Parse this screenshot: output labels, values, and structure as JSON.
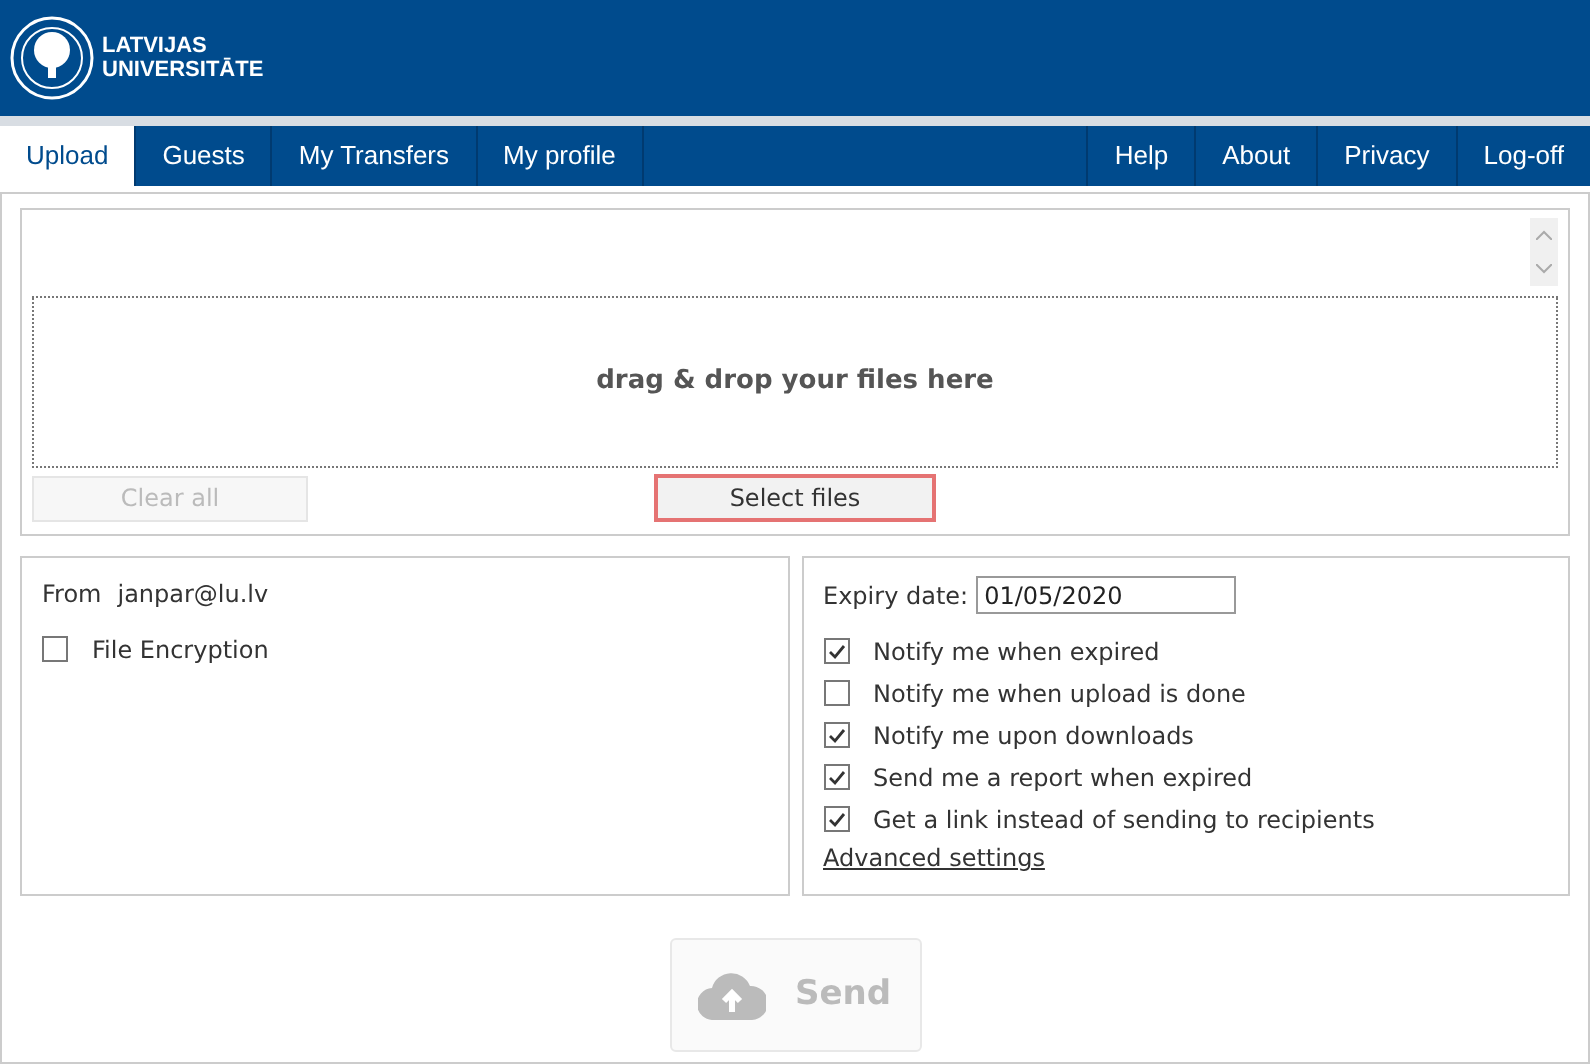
{
  "header": {
    "logo_lines": [
      "LATVIJAS",
      "UNIVERSITĀTE"
    ]
  },
  "nav": {
    "left": [
      {
        "label": "Upload",
        "selected": true
      },
      {
        "label": "Guests",
        "selected": false
      },
      {
        "label": "My Transfers",
        "selected": false
      },
      {
        "label": "My profile",
        "selected": false
      }
    ],
    "right": [
      {
        "label": "Help",
        "selected": false
      },
      {
        "label": "About",
        "selected": false
      },
      {
        "label": "Privacy",
        "selected": false
      },
      {
        "label": "Log-off",
        "selected": false
      }
    ]
  },
  "upload": {
    "drop_text": "drag & drop your files here",
    "clear_button": {
      "label": "Clear all",
      "disabled": true
    },
    "select_button": {
      "label": "Select files",
      "focused": true
    }
  },
  "sender": {
    "from_label": "From",
    "from_value": "janpar@lu.lv",
    "encryption": {
      "label": "File Encryption",
      "checked": false
    }
  },
  "options": {
    "expiry_label": "Expiry date:",
    "expiry_value": "01/05/2020",
    "checkboxes": [
      {
        "label": "Notify me when expired",
        "checked": true
      },
      {
        "label": "Notify me when upload is done",
        "checked": false
      },
      {
        "label": "Notify me upon downloads",
        "checked": true
      },
      {
        "label": "Send me a report when expired",
        "checked": true
      },
      {
        "label": "Get a link instead of sending to recipients",
        "checked": true
      }
    ],
    "advanced_link": "Advanced settings"
  },
  "send_button": {
    "label": "Send",
    "disabled": true
  }
}
